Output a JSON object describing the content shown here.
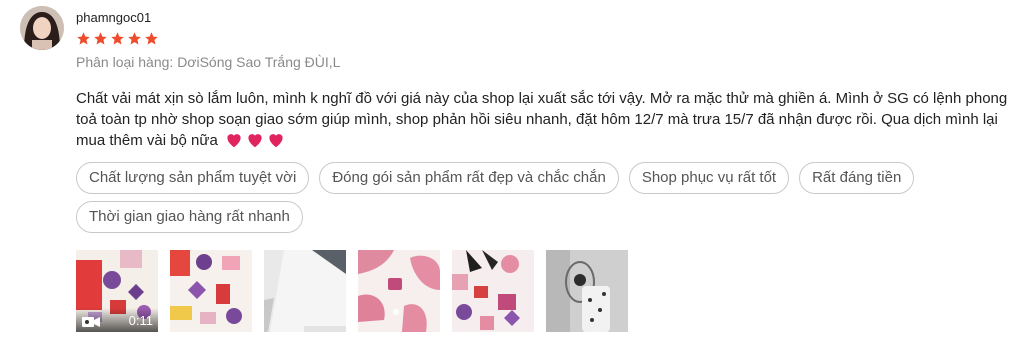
{
  "review": {
    "username": "phamngoc01",
    "rating": 5,
    "variation": "Phân loại hàng: DơiSóng Sao Trắng ĐÙI,L",
    "text": "Chất vải mát xịn sò lắm luôn, mình k nghĩ đồ với giá này của shop lại xuất sắc tới vậy. Mở ra mặc thử mà ghiền á. Mình ở SG có lệnh phong toả toàn tp nhờ shop soạn giao sớm giúp mình, shop phản hồi siêu nhanh, đặt hôm 12/7 mà trưa 15/7 đã nhận được rồi. Qua dịch mình lại mua thêm vài bộ nữa",
    "heart_emoji_count": 3
  },
  "tags": [
    "Chất lượng sản phẩm tuyệt vời",
    "Đóng gói sản phẩm rất đẹp và chắc chắn",
    "Shop phục vụ rất tốt",
    "Rất đáng tiền",
    "Thời gian giao hàng rất nhanh"
  ],
  "media": {
    "video_duration": "0:11",
    "thumbnail_count": 6
  },
  "colors": {
    "star": "#ee4d2d",
    "heart": "#e0245e",
    "tag_border": "#c9c9c9",
    "muted_text": "#8a8a8a"
  },
  "icons": [
    "star-icon",
    "heart-icon",
    "video-camera-icon"
  ]
}
